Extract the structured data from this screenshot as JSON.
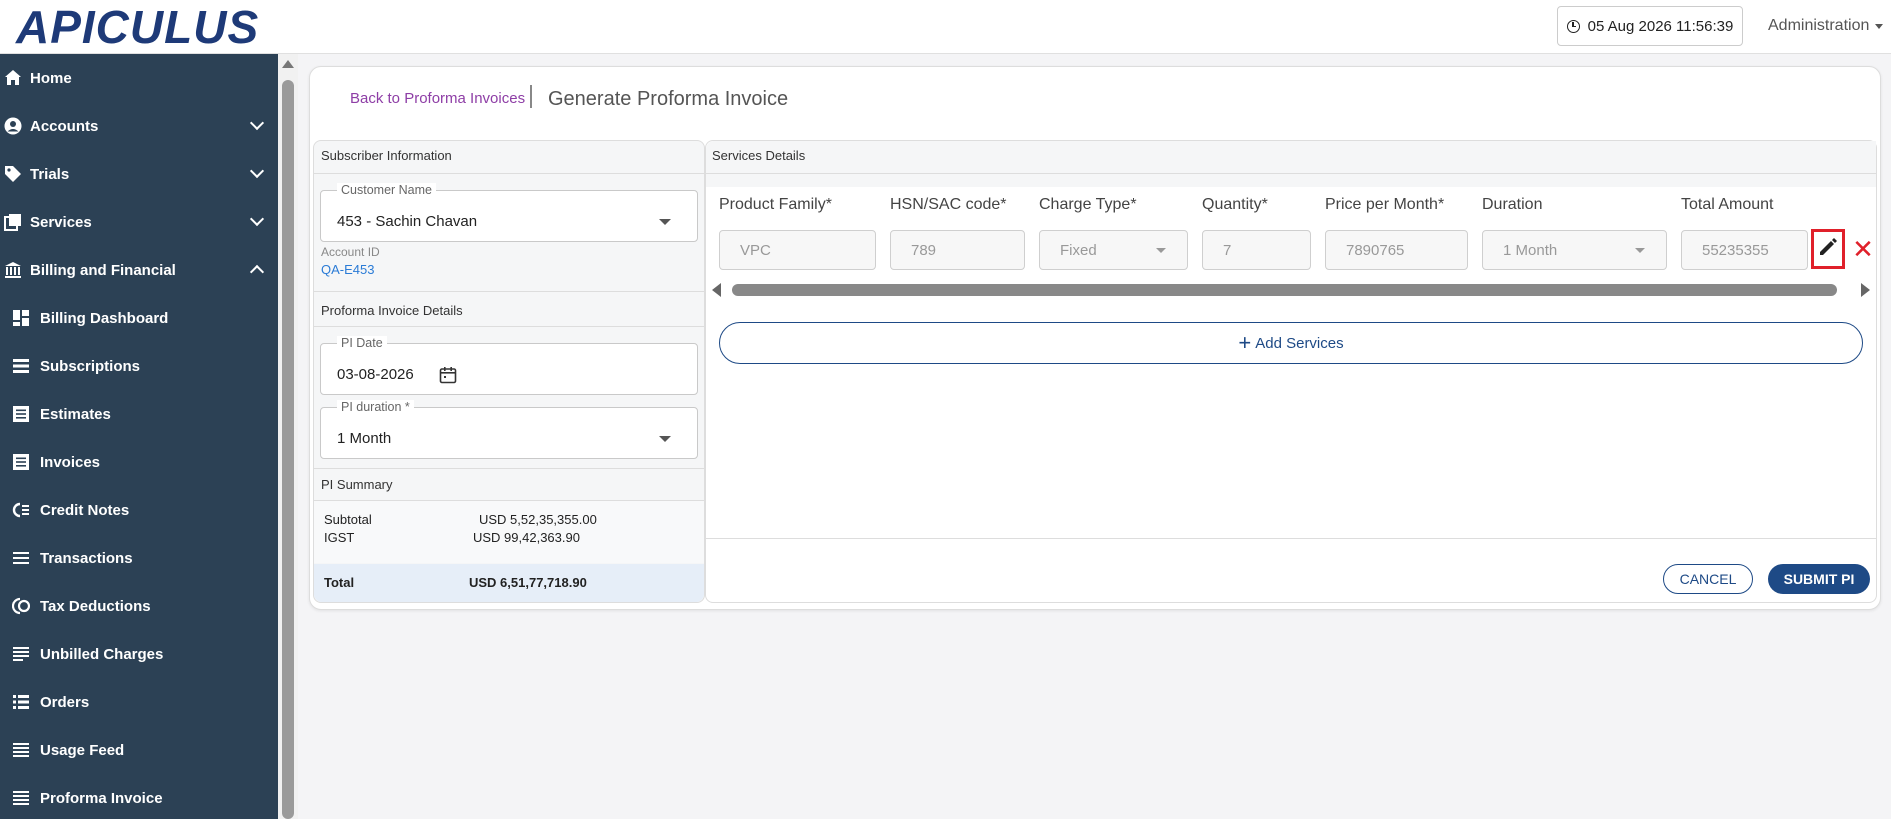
{
  "header": {
    "logo_text": "APICULUS",
    "datetime": "05 Aug 2026 11:56:39",
    "user_menu": "Administration"
  },
  "sidebar": {
    "items": [
      {
        "label": "Home",
        "icon": "home-icon"
      },
      {
        "label": "Accounts",
        "icon": "user-circle-icon",
        "expandable": true
      },
      {
        "label": "Trials",
        "icon": "tag-icon",
        "expandable": true
      },
      {
        "label": "Services",
        "icon": "stack-icon",
        "expandable": true
      },
      {
        "label": "Billing and Financial",
        "icon": "bank-icon",
        "expanded": true
      },
      {
        "label": "Billing Dashboard",
        "icon": "dashboard-icon"
      },
      {
        "label": "Subscriptions",
        "icon": "list-icon"
      },
      {
        "label": "Estimates",
        "icon": "document-icon"
      },
      {
        "label": "Invoices",
        "icon": "invoice-icon"
      },
      {
        "label": "Credit Notes",
        "icon": "credit-note-icon"
      },
      {
        "label": "Transactions",
        "icon": "list-icon"
      },
      {
        "label": "Tax Deductions",
        "icon": "tax-icon"
      },
      {
        "label": "Unbilled Charges",
        "icon": "lines-icon"
      },
      {
        "label": "Orders",
        "icon": "orders-icon"
      },
      {
        "label": "Usage Feed",
        "icon": "list-icon"
      },
      {
        "label": "Proforma Invoice",
        "icon": "list-icon"
      }
    ]
  },
  "page": {
    "back_link": "Back to Proforma Invoices",
    "title": "Generate Proforma Invoice"
  },
  "subscriber": {
    "heading": "Subscriber Information",
    "customer_name_label": "Customer Name",
    "customer_name_value": "453 - Sachin Chavan",
    "account_id_label": "Account ID",
    "account_id_value": "QA-E453"
  },
  "pi_details": {
    "heading": "Proforma Invoice Details",
    "date_label": "PI Date",
    "date_value": "03-08-2026",
    "duration_label": "PI duration *",
    "duration_value": "1 Month"
  },
  "pi_summary": {
    "heading": "PI Summary",
    "subtotal_label": "Subtotal",
    "subtotal_value": "USD 5,52,35,355.00",
    "igst_label": "IGST",
    "igst_value": "USD 99,42,363.90",
    "total_label": "Total",
    "total_value": "USD 6,51,77,718.90"
  },
  "services": {
    "heading": "Services Details",
    "columns": {
      "product_family": "Product Family*",
      "hsn": "HSN/SAC code*",
      "charge_type": "Charge Type*",
      "quantity": "Quantity*",
      "price": "Price per Month*",
      "duration": "Duration",
      "total": "Total Amount"
    },
    "row": {
      "product_family": "VPC",
      "hsn": "789",
      "charge_type": "Fixed",
      "quantity": "7",
      "price": "7890765",
      "duration": "1 Month",
      "total": "55235355"
    },
    "add_button": "Add Services"
  },
  "actions": {
    "cancel": "CANCEL",
    "submit": "SUBMIT PI"
  },
  "colors": {
    "sidebar_bg": "#2c4155",
    "primary": "#1e4a86",
    "link_purple": "#8e3ea6",
    "highlight_red": "#e0202a"
  }
}
